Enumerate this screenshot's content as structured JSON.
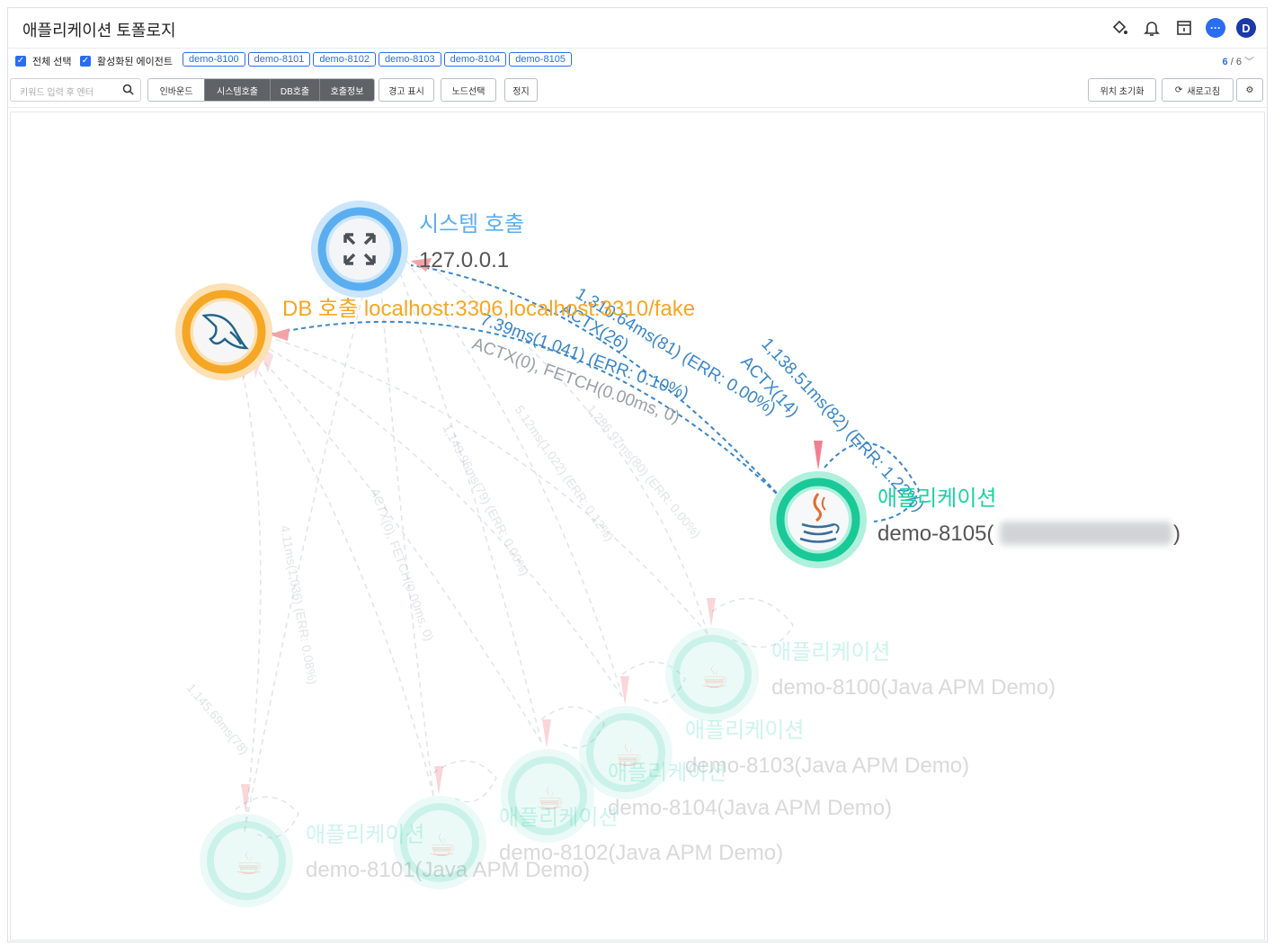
{
  "header": {
    "title": "애플리케이션 토폴로지",
    "avatar_initial": "D"
  },
  "agent_bar": {
    "select_all_label": "전체 선택",
    "active_agents_label": "활성화된 에이전트",
    "agents": [
      "demo-8100",
      "demo-8101",
      "demo-8102",
      "demo-8103",
      "demo-8104",
      "demo-8105"
    ],
    "count_selected": "6",
    "count_total": "/ 6"
  },
  "toolbar": {
    "search_placeholder": "키워드 입력 후 엔터",
    "inbound_label": "인바운드",
    "system_call_label": "시스템호출",
    "db_call_label": "DB호출",
    "call_info_label": "호출정보",
    "warning_label": "경고 표시",
    "node_select_label": "노드선택",
    "stop_label": "정지",
    "reset_position_label": "위치 초기화",
    "refresh_label": "새로고침"
  },
  "topology": {
    "system_node": {
      "title": "시스템 호출",
      "subtitle": "127.0.0.1"
    },
    "db_node": {
      "title": "DB 호출 localhost:3306,localhost:3310/fake"
    },
    "active_app_node": {
      "title": "애플리케이션",
      "subtitle": "demo-8105(",
      "subtitle_end": ")"
    },
    "faded_apps": [
      {
        "title": "애플리케이션",
        "subtitle": "demo-8100(Java APM Demo)"
      },
      {
        "title": "애플리케이션",
        "subtitle": "demo-8103(Java APM Demo)"
      },
      {
        "title": "애플리케이션",
        "subtitle": "demo-8104(Java APM Demo)"
      },
      {
        "title": "애플리케이션",
        "subtitle": "demo-8102(Java APM Demo)"
      },
      {
        "title": "애플리케이션",
        "subtitle": "demo-8101(Java APM Demo)"
      }
    ],
    "edge_labels": {
      "sys_a": "1,310.64ms(81) (ERR: 0.00%)",
      "sys_b": "ACTX(26)",
      "db_a": "7.39ms(1,041) (ERR: 0.10%)",
      "db_b": "ACTX(0), FETCH(0.00ms, 0)",
      "self_a": "1,138.51ms(82) (ERR: 1.22%)",
      "self_b": "ACTX(14)"
    },
    "colors": {
      "system": "#5aaef0",
      "db": "#f5a623",
      "app": "#1dd1a1",
      "edge": "#3a86c8"
    }
  }
}
